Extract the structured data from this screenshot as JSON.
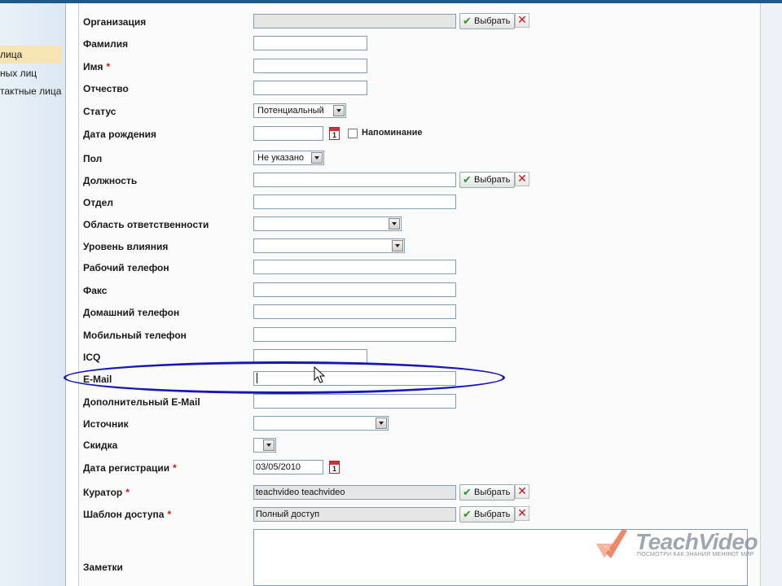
{
  "sidebar": {
    "items": [
      {
        "label": "лица",
        "active": true
      },
      {
        "label": "ных лиц",
        "active": false
      },
      {
        "label": "тактные лица",
        "active": false
      }
    ]
  },
  "form": {
    "organization": {
      "label": "Организация",
      "value": ""
    },
    "last_name": {
      "label": "Фамилия",
      "value": ""
    },
    "first_name": {
      "label": "Имя",
      "required": "*",
      "value": ""
    },
    "middle_name": {
      "label": "Отчество",
      "value": ""
    },
    "status": {
      "label": "Статус",
      "selected": "Потенциальный"
    },
    "birth_date": {
      "label": "Дата рождения",
      "value": "",
      "reminder_label": "Напоминание"
    },
    "gender": {
      "label": "Пол",
      "selected": "Не указано"
    },
    "position": {
      "label": "Должность",
      "value": ""
    },
    "department": {
      "label": "Отдел",
      "value": ""
    },
    "responsibility_area": {
      "label": "Область ответственности",
      "selected": ""
    },
    "influence_level": {
      "label": "Уровень влияния",
      "selected": ""
    },
    "work_phone": {
      "label": "Рабочий телефон",
      "value": ""
    },
    "fax": {
      "label": "Факс",
      "value": ""
    },
    "home_phone": {
      "label": "Домашний телефон",
      "value": ""
    },
    "mobile_phone": {
      "label": "Мобильный телефон",
      "value": ""
    },
    "icq": {
      "label": "ICQ",
      "value": ""
    },
    "email": {
      "label": "E-Mail",
      "value": ""
    },
    "extra_email": {
      "label": "Дополнительный E-Mail",
      "value": ""
    },
    "source": {
      "label": "Источник",
      "selected": ""
    },
    "discount": {
      "label": "Скидка",
      "selected": ""
    },
    "registration_date": {
      "label": "Дата регистрации",
      "required": "*",
      "value": "03/05/2010"
    },
    "curator": {
      "label": "Куратор",
      "required": "*",
      "value": "teachvideo teachvideo"
    },
    "access_template": {
      "label": "Шаблон доступа",
      "required": "*",
      "value": "Полный доступ"
    },
    "notes": {
      "label": "Заметки",
      "value": ""
    }
  },
  "buttons": {
    "choose_label": "Выбрать",
    "clear_symbol": "✕"
  },
  "watermark": {
    "brand": "TeachVideo",
    "tagline": "ПОСМОТРИ КАК ЗНАНИЯ МЕНЯЮТ МИР"
  },
  "colors": {
    "annotation_ellipse": "#1717b8",
    "required_mark": "#dd1111",
    "active_sidebar": "#f6e4b4"
  }
}
